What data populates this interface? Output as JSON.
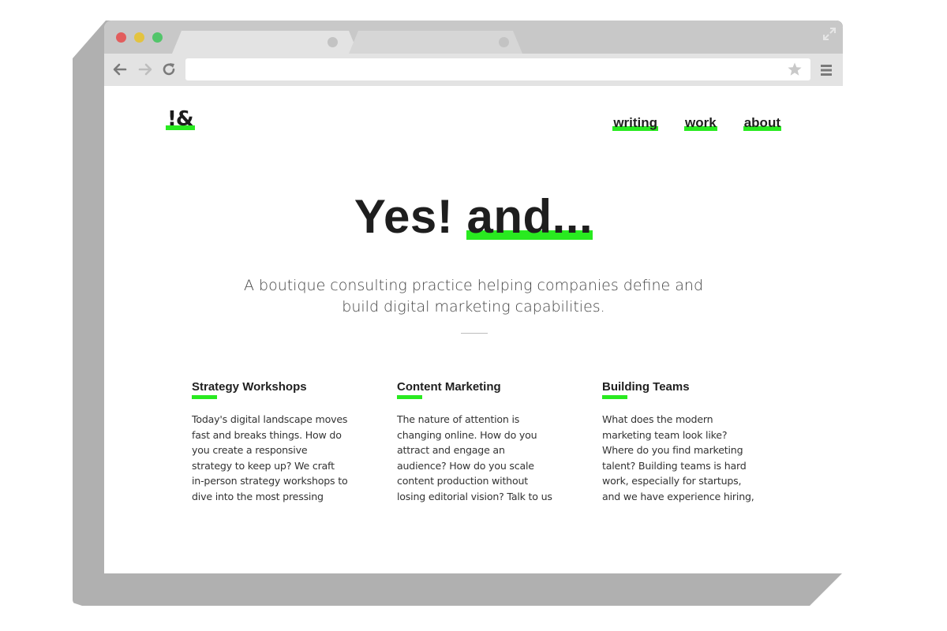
{
  "browser": {
    "address_value": ""
  },
  "site": {
    "logo": "!&",
    "nav": [
      "writing",
      "work",
      "about"
    ]
  },
  "hero": {
    "title_a": "Yes! ",
    "title_b": "and...",
    "subtitle": "A boutique consulting practice helping companies define and build digital marketing capabilities."
  },
  "features": [
    {
      "title": "Strategy Workshops",
      "text": "Today's digital landscape moves fast and breaks things. How do you create a responsive strategy to keep up? We craft in-person strategy workshops to dive into the most pressing issues your"
    },
    {
      "title": "Content Marketing",
      "text": "The nature of attention is changing online. How do you attract and engage an audience? How do you scale content production without losing editorial vision? Talk to us"
    },
    {
      "title": "Building Teams",
      "text": "What does the modern marketing team look like? Where do you find marketing talent? Building teams is hard work, especially for startups, and we have experience hiring,"
    }
  ],
  "colors": {
    "accent": "#29ea20",
    "text": "#1e1e1e",
    "chrome": "#c8c8c8",
    "toolbar": "#e3e3e3",
    "traffic_red": "#e25d5d",
    "traffic_yellow": "#e3c33f",
    "traffic_green": "#52c56a"
  },
  "icons": {
    "back": "back-arrow-icon",
    "forward": "forward-arrow-icon",
    "reload": "reload-icon",
    "bookmark": "star-icon",
    "menu": "hamburger-menu-icon",
    "expand": "expand-icon"
  }
}
